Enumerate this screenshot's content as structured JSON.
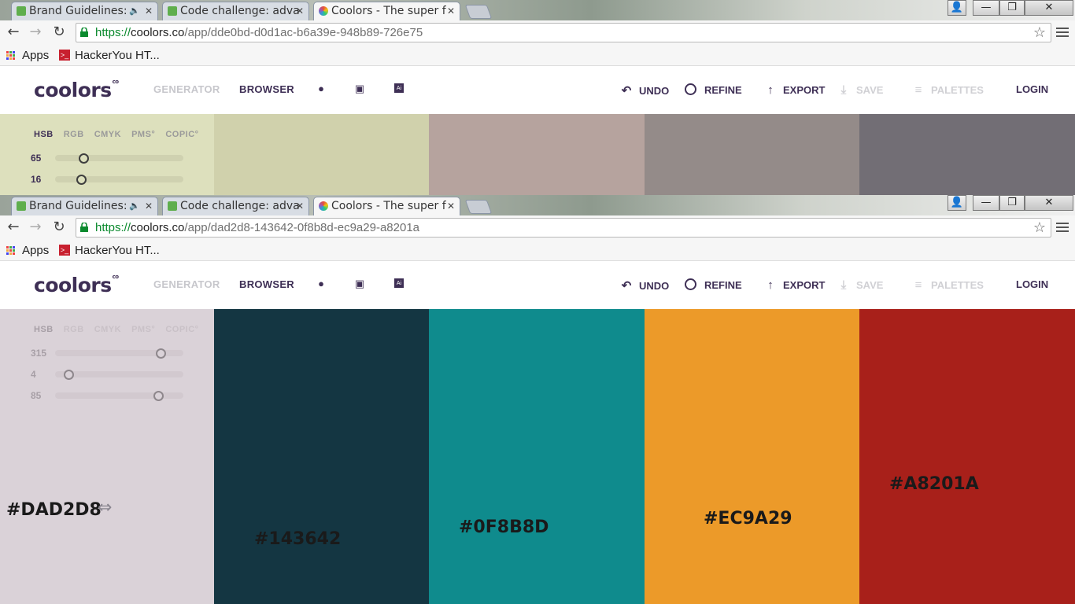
{
  "browser": {
    "tabs": [
      {
        "title": "Brand Guidelines:",
        "muted_audio": true
      },
      {
        "title": "Code challenge: adva",
        "muted_audio": false
      },
      {
        "title": "Coolors - The super f",
        "active": true
      }
    ],
    "window_controls": {
      "user": "👤",
      "minimize": "—",
      "maximize": "❐",
      "close": "✕"
    },
    "nav": {
      "back": "←",
      "forward": "→",
      "reload": "↻"
    },
    "bookmarks": [
      {
        "label": "Apps",
        "icon": "apps-grid-icon"
      },
      {
        "label": "HackerYou HT...",
        "icon": "hackeryou-icon"
      }
    ]
  },
  "app": {
    "logo": "coolors",
    "logo_mark": "co",
    "nav": {
      "generator": "GENERATOR",
      "browser": "BROWSER",
      "apple_icon": "",
      "android_icon": "🤖",
      "ai_icon": "Ai"
    },
    "actions": {
      "undo": "UNDO",
      "refine": "REFINE",
      "export": "EXPORT",
      "save": "SAVE",
      "palettes": "PALETTES",
      "login": "LOGIN"
    },
    "color_modes": [
      "HSB",
      "RGB",
      "CMYK",
      "PMS°",
      "COPIC°"
    ]
  },
  "windows": [
    {
      "url": {
        "scheme": "https://",
        "host": "coolors.co",
        "path": "/app/dde0bd-d0d1ac-b6a39e-948b89-726e75"
      },
      "colors": [
        "#DDE0BD",
        "#D0D1AC",
        "#B6A39E",
        "#948B89",
        "#726E75"
      ],
      "sliders": [
        {
          "label": "65",
          "fraction": 0.2
        },
        {
          "label": "16",
          "fraction": 0.18
        }
      ]
    },
    {
      "url": {
        "scheme": "https://",
        "host": "coolors.co",
        "path": "/app/dad2d8-143642-0f8b8d-ec9a29-a8201a"
      },
      "colors": [
        "#DAD2D8",
        "#143642",
        "#0F8B8D",
        "#EC9A29",
        "#A8201A"
      ],
      "hex_labels": [
        "#DAD2D8",
        "#143642",
        "#0F8B8D",
        "#EC9A29",
        "#A8201A"
      ],
      "swap_icon": "⇔",
      "sliders": [
        {
          "label": "315",
          "fraction": 0.85
        },
        {
          "label": "4",
          "fraction": 0.07
        },
        {
          "label": "85",
          "fraction": 0.83
        }
      ]
    }
  ]
}
